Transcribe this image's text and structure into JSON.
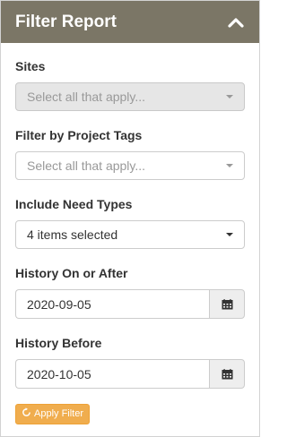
{
  "header": {
    "title": "Filter Report",
    "collapse_icon": "chevron-up-icon"
  },
  "filters": {
    "sites": {
      "label": "Sites",
      "placeholder": "Select all that apply..."
    },
    "project_tags": {
      "label": "Filter by Project Tags",
      "placeholder": "Select all that apply..."
    },
    "need_types": {
      "label": "Include Need Types",
      "value": "4 items selected"
    },
    "history_on_or_after": {
      "label": "History On or After",
      "value": "2020-09-05",
      "icon": "calendar-icon"
    },
    "history_before": {
      "label": "History Before",
      "value": "2020-10-05",
      "icon": "calendar-icon"
    }
  },
  "apply_button": {
    "label": "Apply Filter",
    "icon": "refresh-icon"
  },
  "colors": {
    "header_bg": "#7b7666",
    "apply_bg": "#f0ad4e"
  }
}
